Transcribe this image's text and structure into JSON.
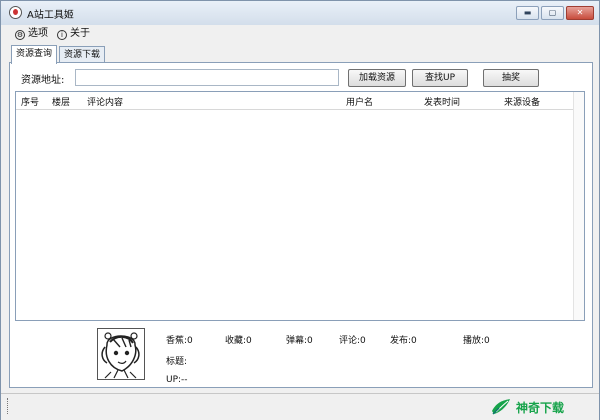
{
  "window": {
    "title": "A站工具姬",
    "controls": {
      "minimize": "▬",
      "maximize": "▢",
      "close": "✕"
    }
  },
  "menu": {
    "options": "选项",
    "about": "关于",
    "options_icon": "gear-icon",
    "about_icon": "info-icon"
  },
  "tabs": [
    {
      "label": "资源查询",
      "active": true
    },
    {
      "label": "资源下载",
      "active": false
    }
  ],
  "resource_query": {
    "url_label": "资源地址:",
    "url_value": "",
    "buttons": {
      "load": "加载资源",
      "find_up": "查找UP",
      "lottery": "抽奖"
    }
  },
  "table": {
    "columns": [
      "序号",
      "楼层",
      "评论内容",
      "用户名",
      "发表时间",
      "来源设备"
    ],
    "rows": []
  },
  "stats": {
    "coins": "香蕉:0",
    "favorites": "收藏:0",
    "danmaku": "弹幕:0",
    "comments": "评论:0",
    "publish": "发布:0",
    "plays": "播放:0"
  },
  "details": {
    "title_label": "标题:",
    "up": "UP:--"
  },
  "watermark": {
    "text": "神奇下载",
    "icon": "leaf-icon",
    "color": "#16a34a"
  }
}
